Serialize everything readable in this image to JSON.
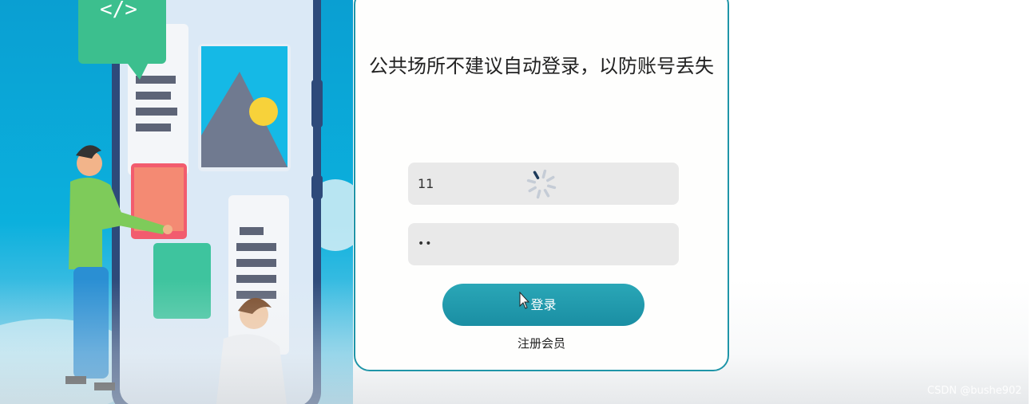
{
  "login": {
    "notice": "公共场所不建议自动登录，以防账号丢失",
    "username_value": "11",
    "password_value": "••",
    "login_button": "登录",
    "register_link": "注册会员"
  },
  "watermark": "CSDN @bushe902",
  "icons": {
    "spinner": "loading-spinner-icon",
    "cursor": "mouse-pointer-icon",
    "code_bubble": "code-icon"
  },
  "colors": {
    "accent": "#1f95a8",
    "button": "#2aa7b7",
    "field_bg": "#e9e9e9",
    "background": "#0bb0dd"
  }
}
